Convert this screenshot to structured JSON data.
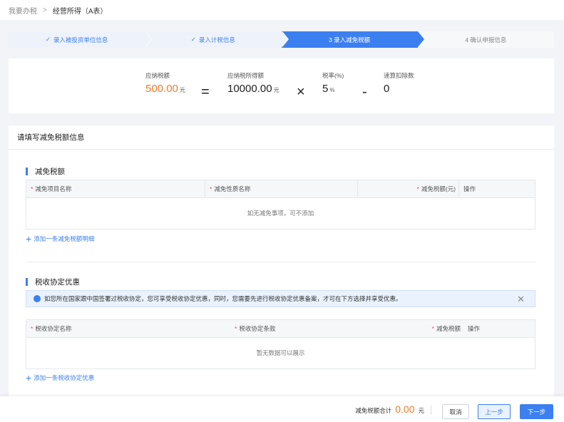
{
  "breadcrumb": {
    "home": "我要办税",
    "current": "经营所得（A表）"
  },
  "steps": [
    {
      "label": "录入被投资单位信息",
      "status": "done"
    },
    {
      "label": "录入计税信息",
      "status": "done"
    },
    {
      "label": "3  录入减免税额",
      "status": "active"
    },
    {
      "label": "4  确认申报信息",
      "status": "todo"
    }
  ],
  "formula": {
    "tax_payable_label": "应纳税额",
    "tax_payable_value": "500.00",
    "tax_payable_unit": "元",
    "equals": "=",
    "taxable_income_label": "应纳税所得额",
    "taxable_income_value": "10000.00",
    "taxable_income_unit": "元",
    "times": "×",
    "rate_label": "税率(%)",
    "rate_value": "5",
    "rate_unit": "%",
    "minus": "-",
    "deduction_label": "速算扣除数",
    "deduction_value": "0"
  },
  "panel": {
    "title": "请填写减免税额信息",
    "reduction_section": {
      "title": "减免税额",
      "columns": [
        "减免项目名称",
        "减免性质名称",
        "减免税额(元)",
        "操作"
      ],
      "empty_text": "如无减免事项，可不添加",
      "add_label": "添加一条减免税额明细"
    },
    "treaty_section": {
      "title": "税收协定优惠",
      "notice": "如您所在国家跟中国签署过税收协定，您可享受税收协定优惠，同时，您需要先进行税收协定优惠备案，才可在下方选择并享受优惠。",
      "columns": [
        "税收协定名称",
        "税收协定条款",
        "减免税额",
        "操作"
      ],
      "empty_text": "暂无数据可以展示",
      "add_label": "添加一条税收协定优惠"
    }
  },
  "footer": {
    "total_label": "减免税额合计",
    "total_value": "0.00",
    "total_unit": "元",
    "cancel": "取消",
    "prev": "上一步",
    "next": "下一步"
  },
  "colors": {
    "accent": "#3c7ff0",
    "highlight": "#f07b26",
    "required": "#f04848"
  }
}
